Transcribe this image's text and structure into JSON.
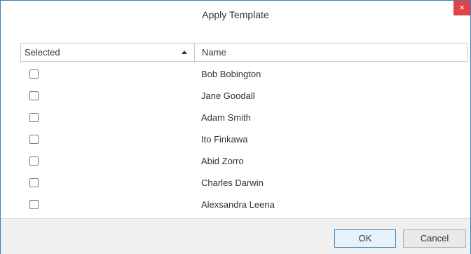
{
  "dialog": {
    "title": "Apply Template",
    "close_glyph": "×"
  },
  "grid": {
    "columns": [
      {
        "label": "Selected",
        "sort": "ascending"
      },
      {
        "label": "Name"
      }
    ],
    "rows": [
      {
        "selected": false,
        "name": "Bob Bobington"
      },
      {
        "selected": false,
        "name": "Jane Goodall"
      },
      {
        "selected": false,
        "name": "Adam Smith"
      },
      {
        "selected": false,
        "name": "Ito Finkawa"
      },
      {
        "selected": false,
        "name": "Abid Zorro"
      },
      {
        "selected": false,
        "name": "Charles Darwin"
      },
      {
        "selected": false,
        "name": "Alexsandra Leena"
      }
    ]
  },
  "footer": {
    "ok_label": "OK",
    "cancel_label": "Cancel"
  },
  "colors": {
    "accent": "#3c7fb1",
    "close_red": "#e04343",
    "footer_bg": "#f0f0f0"
  }
}
